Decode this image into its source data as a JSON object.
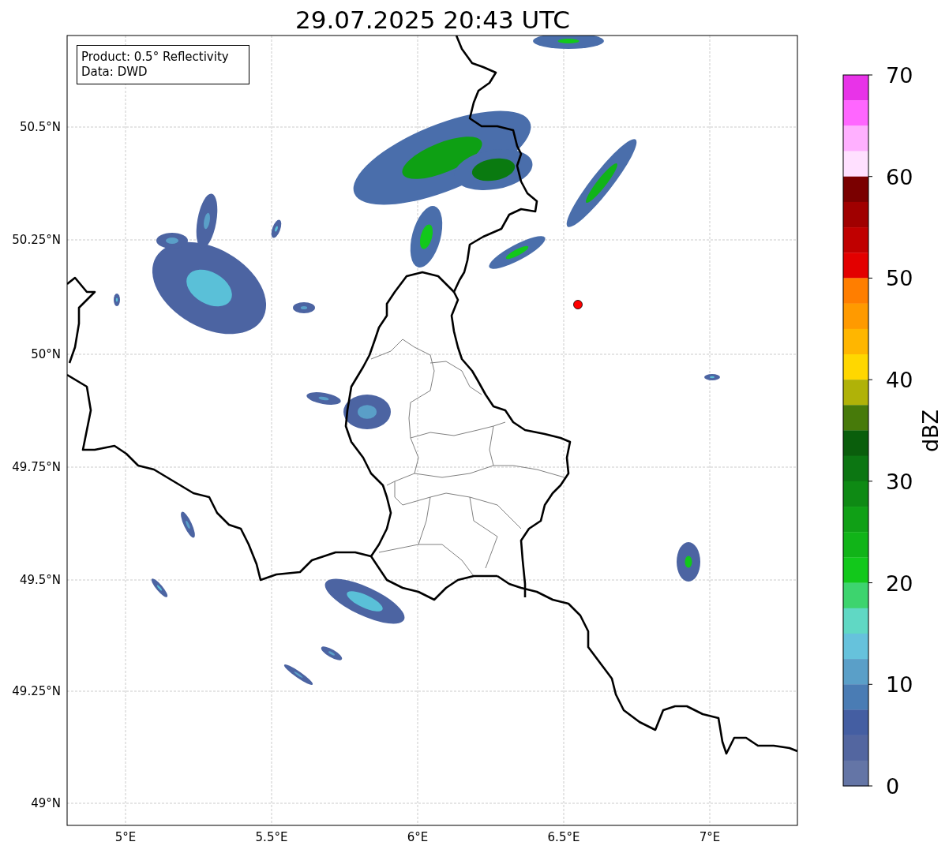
{
  "title": "29.07.2025 20:43 UTC",
  "legend": [
    "Product: 0.5° Reflectivity",
    "Data: DWD"
  ],
  "map": {
    "lat_labels": [
      "50.5°N",
      "50.25°N",
      "50°N",
      "49.75°N",
      "49.5°N",
      "49.25°N",
      "49°N"
    ],
    "lon_labels": [
      "5°E",
      "5.5°E",
      "6°E",
      "6.5°E",
      "7°E"
    ]
  },
  "colorbar": {
    "label": "dBZ",
    "ticks": [
      "70",
      "60",
      "50",
      "40",
      "30",
      "20",
      "10",
      "0"
    ],
    "bins": [
      {
        "color": "#e833e8"
      },
      {
        "color": "#ff66ff"
      },
      {
        "color": "#ffb0ff"
      },
      {
        "color": "#ffe0ff"
      },
      {
        "color": "#7a0000"
      },
      {
        "color": "#a00000"
      },
      {
        "color": "#c00000"
      },
      {
        "color": "#e30000"
      },
      {
        "color": "#ff7e00"
      },
      {
        "color": "#ff9a00"
      },
      {
        "color": "#ffb600"
      },
      {
        "color": "#ffd700"
      },
      {
        "color": "#b0b208"
      },
      {
        "color": "#477a0a"
      },
      {
        "color": "#0a5e0c"
      },
      {
        "color": "#0c7612"
      },
      {
        "color": "#0e8a14"
      },
      {
        "color": "#10a016"
      },
      {
        "color": "#11b418"
      },
      {
        "color": "#12c81b"
      },
      {
        "color": "#3dd46e"
      },
      {
        "color": "#60d8c4"
      },
      {
        "color": "#66c2dc"
      },
      {
        "color": "#5a9fc8"
      },
      {
        "color": "#4a7cb4"
      },
      {
        "color": "#445ea2"
      },
      {
        "color": "#5366a0"
      },
      {
        "color": "#6475a6"
      }
    ]
  }
}
